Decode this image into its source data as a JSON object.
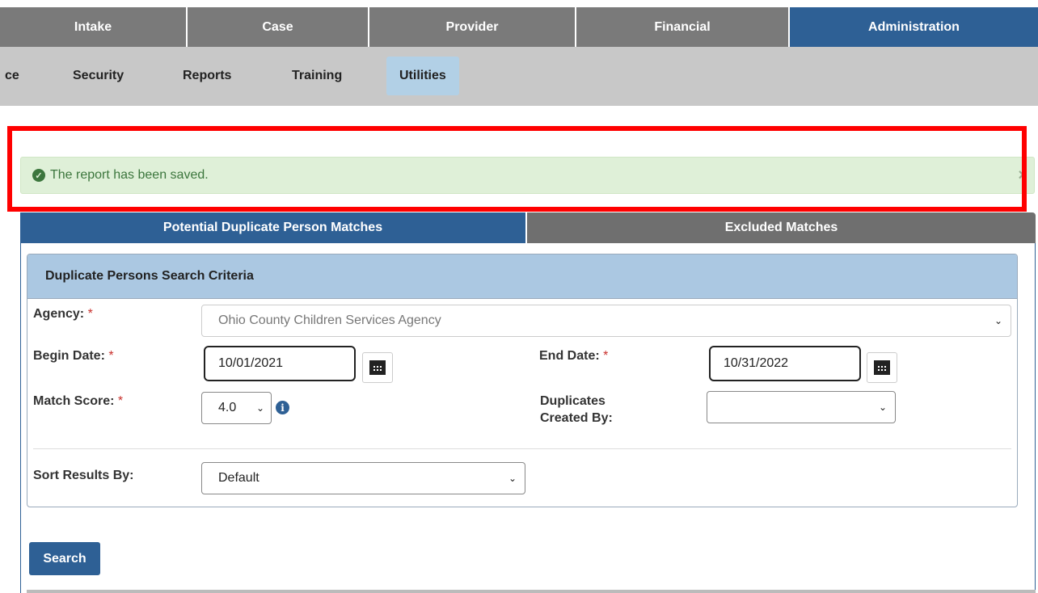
{
  "top_nav": [
    {
      "label": "Intake"
    },
    {
      "label": "Case"
    },
    {
      "label": "Provider"
    },
    {
      "label": "Financial"
    },
    {
      "label": "Administration",
      "active": true
    }
  ],
  "sub_nav": [
    {
      "label": "ce"
    },
    {
      "label": "Security"
    },
    {
      "label": "Reports"
    },
    {
      "label": "Training"
    },
    {
      "label": "Utilities",
      "active": true
    }
  ],
  "alert": {
    "message": "The report has been saved.",
    "close": "×",
    "type": "success"
  },
  "section_tabs": [
    {
      "label": "Potential Duplicate Person Matches",
      "active": true
    },
    {
      "label": "Excluded Matches"
    }
  ],
  "panel": {
    "title": "Duplicate Persons Search Criteria"
  },
  "form": {
    "agency_label": "Agency:",
    "agency_value": "Ohio County Children Services Agency",
    "begin_date_label": "Begin Date:",
    "begin_date_value": "10/01/2021",
    "end_date_label": "End Date:",
    "end_date_value": "10/31/2022",
    "match_score_label": "Match Score:",
    "match_score_value": "4.0",
    "duplicates_created_by_label_1": "Duplicates",
    "duplicates_created_by_label_2": "Created By:",
    "duplicates_created_by_value": "",
    "sort_results_label": "Sort Results By:",
    "sort_results_value": "Default",
    "required_marker": "*"
  },
  "actions": {
    "search_label": "Search"
  },
  "colors": {
    "primary": "#2e6095",
    "nav_inactive": "#7a7a7a",
    "subnav_bg": "#c8c8c8",
    "success_bg": "#dff0d8",
    "success_text": "#3c763d",
    "highlight": "#ff0000",
    "required": "#c9302c"
  }
}
